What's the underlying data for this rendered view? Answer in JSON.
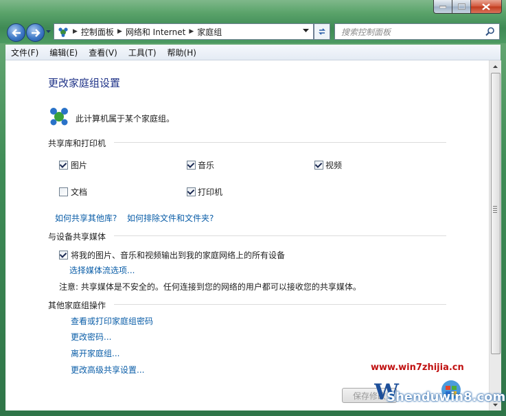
{
  "window": {
    "caption_buttons": [
      "minimize-icon",
      "maximize-icon",
      "close-icon"
    ]
  },
  "nav": {
    "breadcrumbs": [
      "控制面板",
      "网络和 Internet",
      "家庭组"
    ],
    "search_placeholder": "搜索控制面板"
  },
  "menu": [
    "文件(F)",
    "编辑(E)",
    "查看(V)",
    "工具(T)",
    "帮助(H)"
  ],
  "page": {
    "title": "更改家庭组设置",
    "status": "此计算机属于某个家庭组。"
  },
  "share_section": {
    "heading": "共享库和打印机",
    "items": [
      {
        "label": "图片",
        "checked": true
      },
      {
        "label": "音乐",
        "checked": true
      },
      {
        "label": "视频",
        "checked": true
      },
      {
        "label": "文档",
        "checked": false
      },
      {
        "label": "打印机",
        "checked": true
      }
    ],
    "link_other_libraries": "如何共享其他库?",
    "link_exclude": "如何排除文件和文件夹?"
  },
  "media_section": {
    "heading": "与设备共享媒体",
    "stream_label": "将我的图片、音乐和视频输出到我的家庭网络上的所有设备",
    "stream_checked": true,
    "stream_options_link": "选择媒体流选项...",
    "note": "注意: 共享媒体是不安全的。任何连接到您的网络的用户都可以接收您的共享媒体。"
  },
  "other_section": {
    "heading": "其他家庭组操作",
    "links": [
      "查看或打印家庭组密码",
      "更改密码...",
      "离开家庭组...",
      "更改高级共享设置..."
    ]
  },
  "buttons": {
    "save": "保存修改"
  },
  "watermark": {
    "url": "www.win7zhijia.cn",
    "brand": "Shenduwin8.com"
  }
}
